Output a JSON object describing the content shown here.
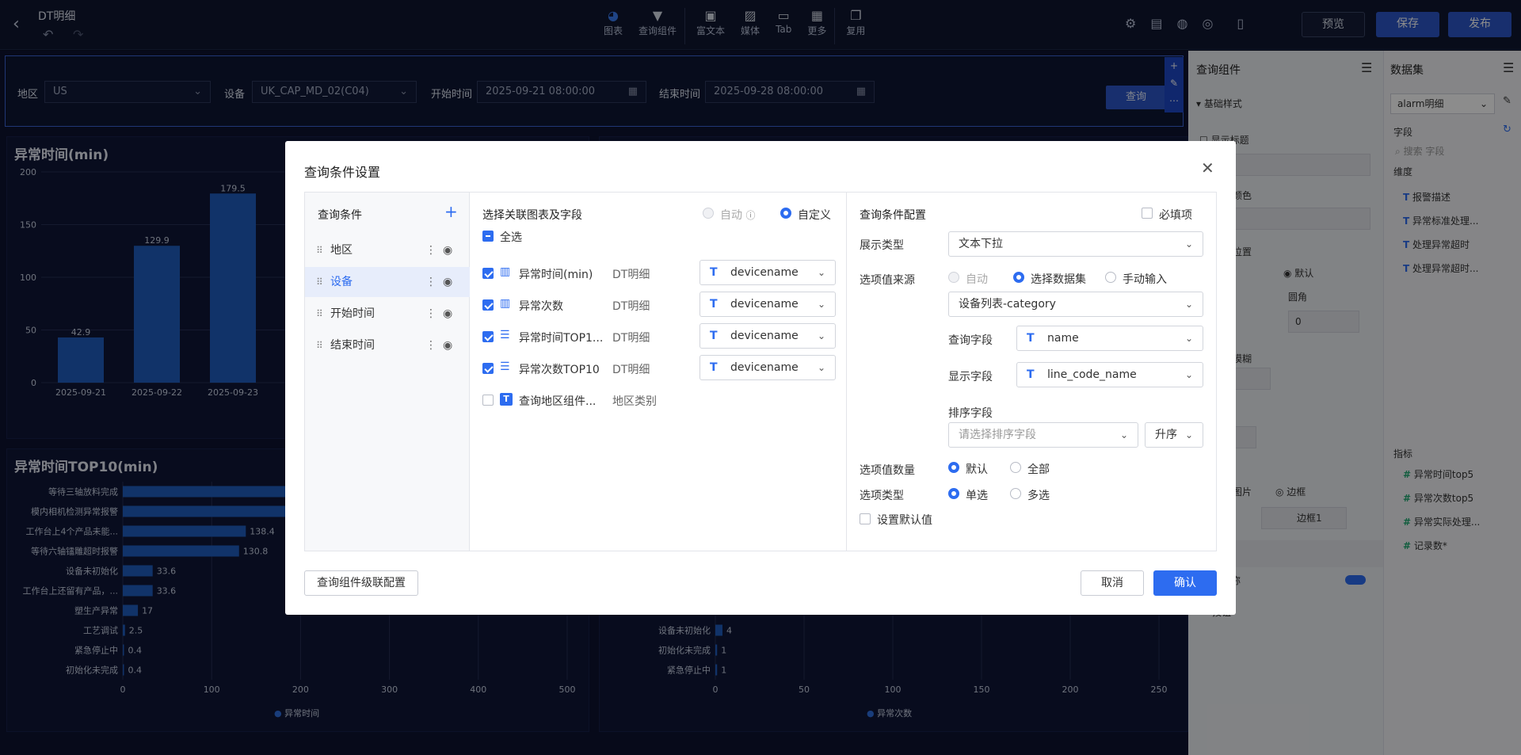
{
  "header": {
    "title": "DT明细",
    "tools": [
      {
        "label": "图表",
        "icon": "pie-chart-icon"
      },
      {
        "label": "查询组件",
        "icon": "filter-icon"
      },
      {
        "label": "富文本",
        "icon": "text-icon"
      },
      {
        "label": "媒体",
        "icon": "image-icon"
      },
      {
        "label": "Tab",
        "icon": "folder-icon"
      },
      {
        "label": "更多",
        "icon": "grid-icon"
      },
      {
        "label": "复用",
        "icon": "copy-icon"
      }
    ],
    "preview": "预览",
    "save": "保存",
    "publish": "发布"
  },
  "query_bar": {
    "region_label": "地区",
    "region_value": "US",
    "device_label": "设备",
    "device_value": "UK_CAP_MD_02(C04)",
    "start_label": "开始时间",
    "start_value": "2025-09-21 08:00:00",
    "end_label": "结束时间",
    "end_value": "2025-09-28 08:00:00",
    "query_btn": "查询"
  },
  "charts": {
    "top_left_title": "异常时间(min)",
    "bottom_left_title": "异常时间TOP10(min)",
    "bottom_left_legend": "异常时间",
    "bottom_right_legend": "异常次数"
  },
  "chart_data": [
    {
      "type": "bar",
      "title": "异常时间(min)",
      "categories": [
        "2025-09-21",
        "2025-09-22",
        "2025-09-23"
      ],
      "values": [
        42.9,
        129.9,
        179.5
      ],
      "yticks": [
        0,
        50,
        100,
        150,
        200
      ],
      "ylim": [
        0,
        200
      ]
    },
    {
      "type": "bar",
      "orientation": "horizontal",
      "title": "异常时间TOP10(min)",
      "categories": [
        "等待三轴放料完成",
        "模内相机检测异常报警",
        "工作台上4个产品未能...",
        "等待六轴镭雕超时报警",
        "设备未初始化",
        "工作台上还留有产品，...",
        "塑生产异常",
        "工艺调试",
        "紧急停止中",
        "初始化未完成"
      ],
      "values": [
        null,
        null,
        138.4,
        130.8,
        33.6,
        33.6,
        17,
        2.5,
        0.4,
        0.4
      ],
      "xticks": [
        0,
        100,
        200,
        300,
        400,
        500
      ],
      "xlim": [
        0,
        500
      ],
      "series_name": "异常时间"
    },
    {
      "type": "bar",
      "orientation": "horizontal",
      "categories": [
        "设备未初始化",
        "初始化未完成",
        "紧急停止中"
      ],
      "values": [
        4,
        1,
        1
      ],
      "xticks": [
        0,
        50,
        100,
        150,
        200,
        250
      ],
      "xlim": [
        0,
        250
      ],
      "series_name": "异常次数"
    }
  ],
  "right_panel": {
    "title": "查询组件",
    "section": "基础样式",
    "show_title": "显示标题",
    "color_label": "颜色",
    "position_label": "位置",
    "default_label": "默认",
    "radius_label": "圆角",
    "radius_value": "0",
    "blur_label": "模糊",
    "image_label": "图片",
    "border_label": "边框",
    "border_value": "边框1",
    "component_label": "件",
    "component_name_label": "件名称",
    "bottom_label": "按钮"
  },
  "dataset_panel": {
    "title": "数据集",
    "dataset": "alarm明细",
    "fields_label": "字段",
    "search_placeholder": "搜索 字段",
    "dims_label": "维度",
    "dims": [
      "报警描述",
      "异常标准处理...",
      "处理异常超时",
      "处理异常超时..."
    ],
    "metrics_label": "指标",
    "metrics": [
      "异常时间top5",
      "异常次数top5",
      "异常实际处理...",
      "记录数*"
    ]
  },
  "modal": {
    "title": "查询条件设置",
    "conditions_title": "查询条件",
    "conditions": [
      "地区",
      "设备",
      "开始时间",
      "结束时间"
    ],
    "link_title": "选择关联图表及字段",
    "auto": "自动",
    "custom": "自定义",
    "select_all": "全选",
    "links": [
      {
        "name": "异常时间(min)",
        "dataset": "DT明细",
        "field": "devicename",
        "checked": true
      },
      {
        "name": "异常次数",
        "dataset": "DT明细",
        "field": "devicename",
        "checked": true
      },
      {
        "name": "异常时间TOP1...",
        "dataset": "DT明细",
        "field": "devicename",
        "checked": true
      },
      {
        "name": "异常次数TOP10",
        "dataset": "DT明细",
        "field": "devicename",
        "checked": true
      },
      {
        "name": "查询地区组件...",
        "dataset": "地区类别",
        "field": "",
        "checked": false
      }
    ],
    "config_title": "查询条件配置",
    "required": "必填项",
    "display_type_label": "展示类型",
    "display_type_value": "文本下拉",
    "source_label": "选项值来源",
    "source_auto": "自动",
    "source_dataset": "选择数据集",
    "source_manual": "手动输入",
    "dataset_value": "设备列表-category",
    "query_field_label": "查询字段",
    "query_field_value": "name",
    "display_field_label": "显示字段",
    "display_field_value": "line_code_name",
    "sort_field_label": "排序字段",
    "sort_placeholder": "请选择排序字段",
    "sort_order": "升序",
    "count_label": "选项值数量",
    "count_default": "默认",
    "count_all": "全部",
    "type_label": "选项类型",
    "type_single": "单选",
    "type_multi": "多选",
    "default_value": "设置默认值",
    "cascade_btn": "查询组件级联配置",
    "cancel": "取消",
    "confirm": "确认"
  }
}
